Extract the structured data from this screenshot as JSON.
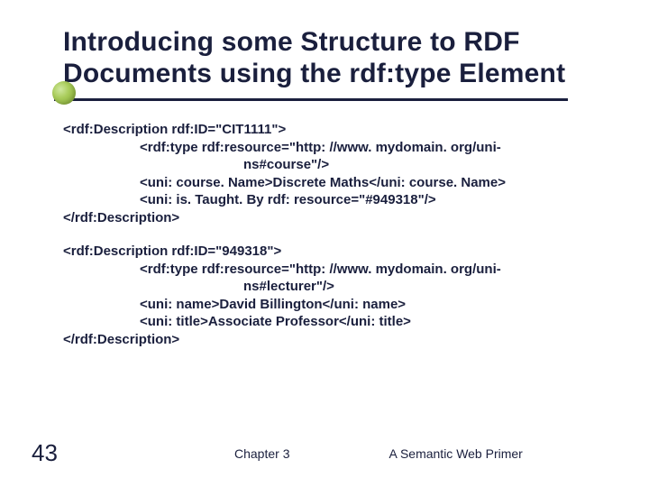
{
  "title_line1": "Introducing some Structure to RDF",
  "title_line2": "Documents using the rdf:type Element",
  "block1": {
    "l1": "<rdf:Description rdf:ID=\"CIT1111\">",
    "l2": "<rdf:type rdf:resource=\"http: //www. mydomain. org/uni-",
    "l3": "ns#course\"/>",
    "l4": "<uni: course. Name>Discrete Maths</uni: course. Name>",
    "l5": "<uni: is. Taught. By rdf: resource=\"#949318\"/>",
    "l6": "</rdf:Description>"
  },
  "block2": {
    "l1": "<rdf:Description rdf:ID=\"949318\">",
    "l2": "<rdf:type rdf:resource=\"http: //www. mydomain. org/uni-",
    "l3": "ns#lecturer\"/>",
    "l4": "<uni: name>David Billington</uni: name>",
    "l5": "<uni: title>Associate Professor</uni: title>",
    "l6": "</rdf:Description>"
  },
  "footer": {
    "slide_number": "43",
    "center": "Chapter 3",
    "right": "A Semantic Web Primer"
  }
}
